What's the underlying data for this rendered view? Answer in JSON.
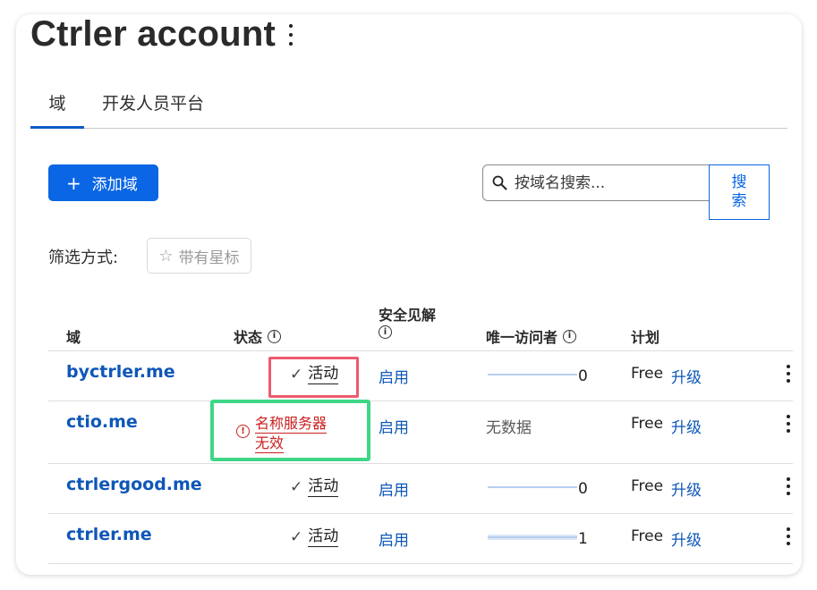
{
  "header": {
    "title": "Ctrler account"
  },
  "tabs": [
    {
      "label": "域",
      "active": true
    },
    {
      "label": "开发人员平台",
      "active": false
    }
  ],
  "toolbar": {
    "add_label": "添加域",
    "add_icon": "plus-icon",
    "search_placeholder": "按域名搜索...",
    "search_button_label": "搜索"
  },
  "filter": {
    "label": "筛选方式:",
    "starred_label": "带有星标"
  },
  "table": {
    "headers": {
      "domain": "域",
      "status": "状态",
      "security_line1": "安全见解",
      "unique_visitors": "唯一访问者",
      "plan": "计划"
    },
    "rows": [
      {
        "domain": "byctrler.me",
        "status": "活动",
        "status_type": "ok",
        "security": "启用",
        "visitors": "0",
        "visitors_level": 0,
        "plan": "Free",
        "upgrade": "升级"
      },
      {
        "domain": "ctio.me",
        "status_line1": "名称服务器",
        "status_line2": "无效",
        "status_type": "error",
        "security": "启用",
        "visitors_text": "无数据",
        "plan": "Free",
        "upgrade": "升级"
      },
      {
        "domain": "ctrlergood.me",
        "status": "活动",
        "status_type": "ok",
        "security": "启用",
        "visitors": "0",
        "visitors_level": 0,
        "plan": "Free",
        "upgrade": "升级"
      },
      {
        "domain": "ctrler.me",
        "status": "活动",
        "status_type": "ok",
        "security": "启用",
        "visitors": "1",
        "visitors_level": 1,
        "plan": "Free",
        "upgrade": "升级"
      }
    ]
  },
  "colors": {
    "accent": "#0a66e4",
    "link": "#0e57b8",
    "error": "#c8201e",
    "highlight_red": "#ee5a6f",
    "highlight_green": "#3fd787"
  }
}
